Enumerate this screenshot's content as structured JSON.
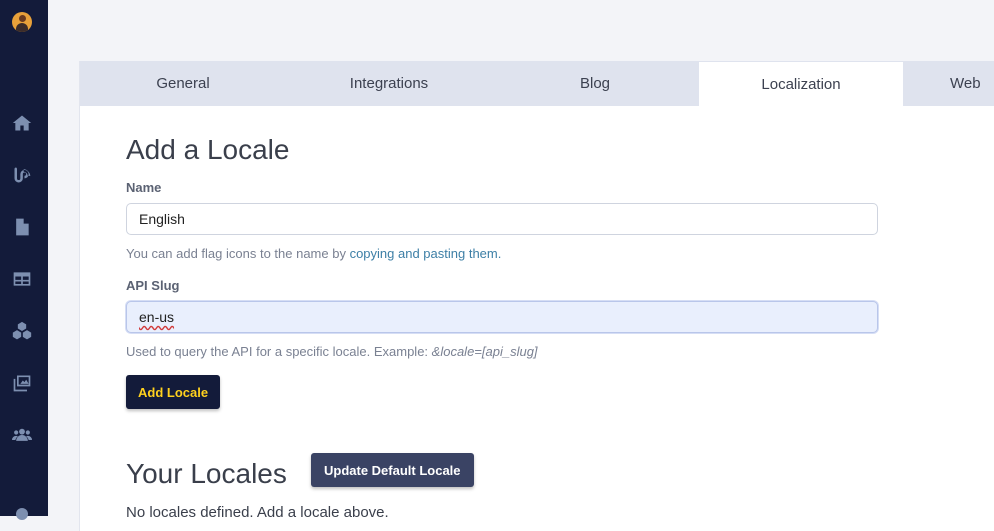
{
  "sidebar": {
    "items": [
      {
        "icon": "home-icon"
      },
      {
        "icon": "blog-icon"
      },
      {
        "icon": "page-icon"
      },
      {
        "icon": "table-icon"
      },
      {
        "icon": "components-icon"
      },
      {
        "icon": "media-icon"
      },
      {
        "icon": "users-icon"
      }
    ]
  },
  "tabs": [
    {
      "label": "General"
    },
    {
      "label": "Integrations"
    },
    {
      "label": "Blog"
    },
    {
      "label": "Localization",
      "active": true
    },
    {
      "label": "Web"
    }
  ],
  "add_locale": {
    "title": "Add a Locale",
    "name_label": "Name",
    "name_value": "English",
    "name_help_prefix": "You can add flag icons to the name by ",
    "name_help_link": "copying and pasting them.",
    "slug_label": "API Slug",
    "slug_value": "en-us",
    "slug_help_prefix": "Used to query the API for a specific locale. Example: ",
    "slug_help_example": "&locale=[api_slug]",
    "submit_label": "Add Locale"
  },
  "your_locales": {
    "title": "Your Locales",
    "update_default_label": "Update Default Locale",
    "empty_text": "No locales defined. Add a locale above."
  },
  "colors": {
    "sidebar_bg": "#131b3a",
    "accent_yellow": "#ffd11e",
    "link": "#3d7fa6"
  }
}
